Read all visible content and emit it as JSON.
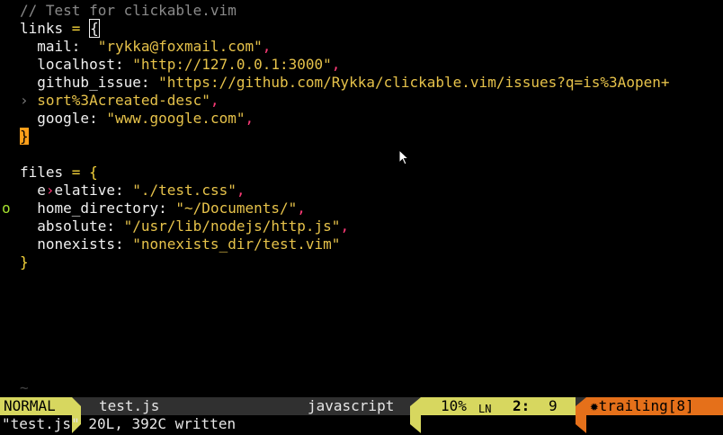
{
  "buffer": {
    "l1": {
      "comment": "// Test for clickable.vim"
    },
    "l2": {
      "key": "links",
      "op": " = ",
      "brace": "{"
    },
    "l3": {
      "indent": "  ",
      "key": "mail:",
      "pad": "  ",
      "str": "\"rykka@foxmail.com\"",
      "punct": ","
    },
    "l4": {
      "indent": "  ",
      "key": "localhost:",
      "pad": " ",
      "str": "\"http://127.0.0.1:3000\"",
      "punct": ","
    },
    "l5": {
      "indent": "  ",
      "key": "github_issue:",
      "pad": " ",
      "str": "\"https://github.com/Rykka/clickable.vim/issues?q=is%3Aopen+"
    },
    "l6": {
      "wrap": "› ",
      "str": "sort%3Acreated-desc\"",
      "punct": ","
    },
    "l7": {
      "indent": "  ",
      "key": "google:",
      "pad": " ",
      "str": "\"www.google.com\"",
      "punct": ","
    },
    "l8": {
      "brace": "}"
    },
    "l10": {
      "key": "files",
      "op": " = ",
      "brace": "{"
    },
    "l11": {
      "sign": "o",
      "indent": "  ",
      "key_a": "e",
      "caret": "›",
      "key_b": "elative:",
      "pad": " ",
      "str": "\"./test.css\"",
      "punct": ","
    },
    "l12": {
      "indent": "  ",
      "key": "home_directory:",
      "pad": " ",
      "str": "\"~/Documents/\"",
      "punct": ","
    },
    "l13": {
      "indent": "  ",
      "key": "absolute:",
      "pad": " ",
      "str": "\"/usr/lib/nodejs/http.js\"",
      "punct": ","
    },
    "l14": {
      "indent": "  ",
      "key": "nonexists:",
      "pad": " ",
      "str": "\"nonexists_dir/test.vim\""
    },
    "l15": {
      "brace": "}"
    },
    "tilde": "~"
  },
  "statusline": {
    "mode": "NORMAL",
    "filename": "test.js",
    "filetype": "javascript",
    "percent": "10%",
    "ln_icon": "LN",
    "line": "2:",
    "col": "9",
    "trailing_icon": "✹",
    "trailing": "trailing[8]"
  },
  "cmdline": "\"test.js\" 20L, 392C written",
  "colors": {
    "string": "#e6c24a",
    "punct": "#ff3b78",
    "mode_bg": "#d7d75f",
    "trailing_bg": "#e5701a"
  },
  "icons": {
    "cursor": "mouse-pointer-icon",
    "sign": "sign-marker-icon",
    "ln": "line-number-icon",
    "trailing": "warning-star-icon"
  }
}
